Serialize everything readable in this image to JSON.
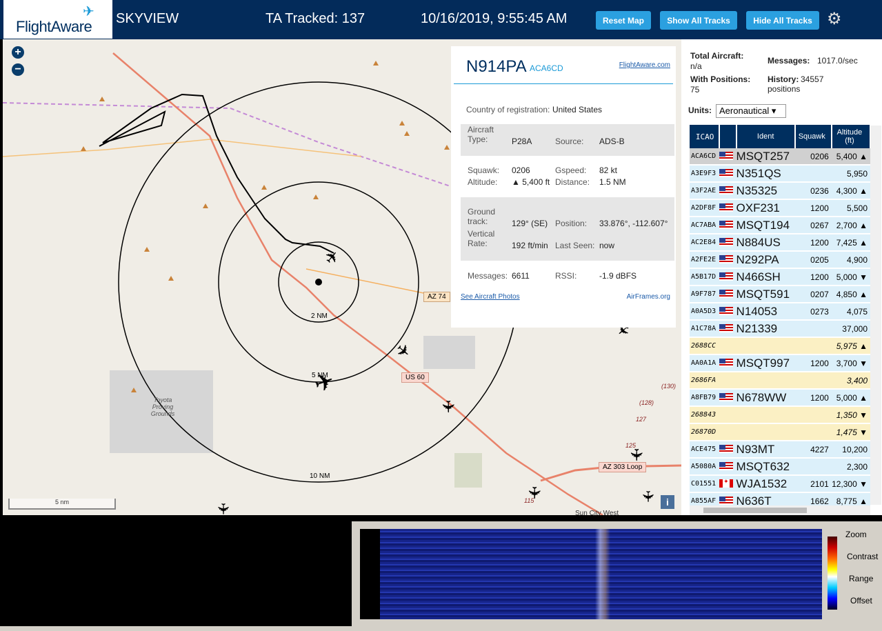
{
  "header": {
    "logo": "FlightAware",
    "app_name": "SKYVIEW",
    "tracked": "TA Tracked: 137",
    "datetime": "10/16/2019, 9:55:45 AM",
    "buttons": {
      "reset_map": "Reset Map",
      "show_all": "Show All Tracks",
      "hide_all": "Hide All Tracks"
    }
  },
  "map": {
    "zoom_in": "+",
    "zoom_out": "−",
    "ring_labels": [
      "2 NM",
      "5 NM",
      "10 NM"
    ],
    "road_labels": [
      "AZ 74",
      "US 60",
      "AZ 303 Loop"
    ],
    "place_labels": [
      "Toyota Proving Grounds",
      "Sun City West"
    ],
    "scale": "5 nm",
    "info": "i",
    "road_numbers": [
      "(130)",
      "(128)",
      "127",
      "125",
      "115"
    ]
  },
  "popup": {
    "registration": "N914PA",
    "icao": "ACA6CD",
    "fa_link": "FlightAware.com",
    "country_label": "Country of registration:",
    "country_value": "United States",
    "aircraft_type_label": "Aircraft Type:",
    "aircraft_type_value": "P28A",
    "source_label": "Source:",
    "source_value": "ADS-B",
    "squawk_label": "Squawk:",
    "squawk_value": "0206",
    "gspeed_label": "Gspeed:",
    "gspeed_value": "82 kt",
    "altitude_label": "Altitude:",
    "altitude_value": "▲ 5,400 ft",
    "distance_label": "Distance:",
    "distance_value": "1.5 NM",
    "ground_track_label": "Ground track:",
    "ground_track_value": "129° (SE)",
    "position_label": "Position:",
    "position_value": "33.876°, -112.607°",
    "vertical_rate_label": "Vertical Rate:",
    "vertical_rate_value": "192 ft/min",
    "last_seen_label": "Last Seen:",
    "last_seen_value": "now",
    "messages_label": "Messages:",
    "messages_value": "6611",
    "rssi_label": "RSSI:",
    "rssi_value": "-1.9 dBFS",
    "photos_link": "See Aircraft Photos",
    "airframes_link": "AirFrames.org"
  },
  "stats": {
    "total_label": "Total Aircraft:",
    "total_value": "n/a",
    "messages_label": "Messages:",
    "messages_value": "1017.0/sec",
    "positions_label": "With Positions:",
    "positions_value": "75",
    "history_label": "History:",
    "history_value": "34557 positions",
    "units_label": "Units:",
    "units_value": "Aeronautical"
  },
  "table": {
    "headers": {
      "icao": "ICAO",
      "ident": "Ident",
      "squawk": "Squawk",
      "altitude": "Altitude (ft)"
    },
    "rows": [
      {
        "icao": "ACA6CD",
        "flag": "us",
        "ident": "MSQT257",
        "squawk": "0206",
        "alt": "5,400 ▲",
        "style": "sel"
      },
      {
        "icao": "A3E9F3",
        "flag": "us",
        "ident": "N351QS",
        "squawk": "",
        "alt": "5,950",
        "style": "blue"
      },
      {
        "icao": "A3F2AE",
        "flag": "us",
        "ident": "N35325",
        "squawk": "0236",
        "alt": "4,300 ▲",
        "style": "blue"
      },
      {
        "icao": "A2DF8F",
        "flag": "us",
        "ident": "OXF231",
        "squawk": "1200",
        "alt": "5,500",
        "style": "blue"
      },
      {
        "icao": "AC7ABA",
        "flag": "us",
        "ident": "MSQT194",
        "squawk": "0267",
        "alt": "2,700 ▲",
        "style": "blue"
      },
      {
        "icao": "AC2E84",
        "flag": "us",
        "ident": "N884US",
        "squawk": "1200",
        "alt": "7,425 ▲",
        "style": "blue"
      },
      {
        "icao": "A2FE2E",
        "flag": "us",
        "ident": "N292PA",
        "squawk": "0205",
        "alt": "4,900",
        "style": "blue"
      },
      {
        "icao": "A5B17D",
        "flag": "us",
        "ident": "N466SH",
        "squawk": "1200",
        "alt": "5,000 ▼",
        "style": "blue"
      },
      {
        "icao": "A9F787",
        "flag": "us",
        "ident": "MSQT591",
        "squawk": "0207",
        "alt": "4,850 ▲",
        "style": "blue"
      },
      {
        "icao": "A0A5D3",
        "flag": "us",
        "ident": "N14053",
        "squawk": "0273",
        "alt": "4,075",
        "style": "blue"
      },
      {
        "icao": "A1C78A",
        "flag": "us",
        "ident": "N21339",
        "squawk": "",
        "alt": "37,000",
        "style": "blue"
      },
      {
        "icao": "2688CC",
        "flag": "",
        "ident": "",
        "squawk": "",
        "alt": "5,975 ▲",
        "style": "yellow"
      },
      {
        "icao": "AA0A1A",
        "flag": "us",
        "ident": "MSQT997",
        "squawk": "1200",
        "alt": "3,700 ▼",
        "style": "blue"
      },
      {
        "icao": "2686FA",
        "flag": "",
        "ident": "",
        "squawk": "",
        "alt": "3,400",
        "style": "yellow"
      },
      {
        "icao": "A8FB79",
        "flag": "us",
        "ident": "N678WW",
        "squawk": "1200",
        "alt": "5,000 ▲",
        "style": "blue"
      },
      {
        "icao": "268843",
        "flag": "",
        "ident": "",
        "squawk": "",
        "alt": "1,350 ▼",
        "style": "yellow"
      },
      {
        "icao": "26870D",
        "flag": "",
        "ident": "",
        "squawk": "",
        "alt": "1,475 ▼",
        "style": "yellow"
      },
      {
        "icao": "ACE475",
        "flag": "us",
        "ident": "N93MT",
        "squawk": "4227",
        "alt": "10,200",
        "style": "blue"
      },
      {
        "icao": "A5080A",
        "flag": "us",
        "ident": "MSQT632",
        "squawk": "",
        "alt": "2,300",
        "style": "blue"
      },
      {
        "icao": "C01551",
        "flag": "ca",
        "ident": "WJA1532",
        "squawk": "2101",
        "alt": "12,300 ▼",
        "style": "blue"
      },
      {
        "icao": "A855AF",
        "flag": "us",
        "ident": "N636T",
        "squawk": "1662",
        "alt": "8,775 ▲",
        "style": "blue"
      }
    ]
  },
  "spectrum": {
    "zoom": "Zoom",
    "contrast": "Contrast",
    "range": "Range",
    "offset": "Offset"
  }
}
